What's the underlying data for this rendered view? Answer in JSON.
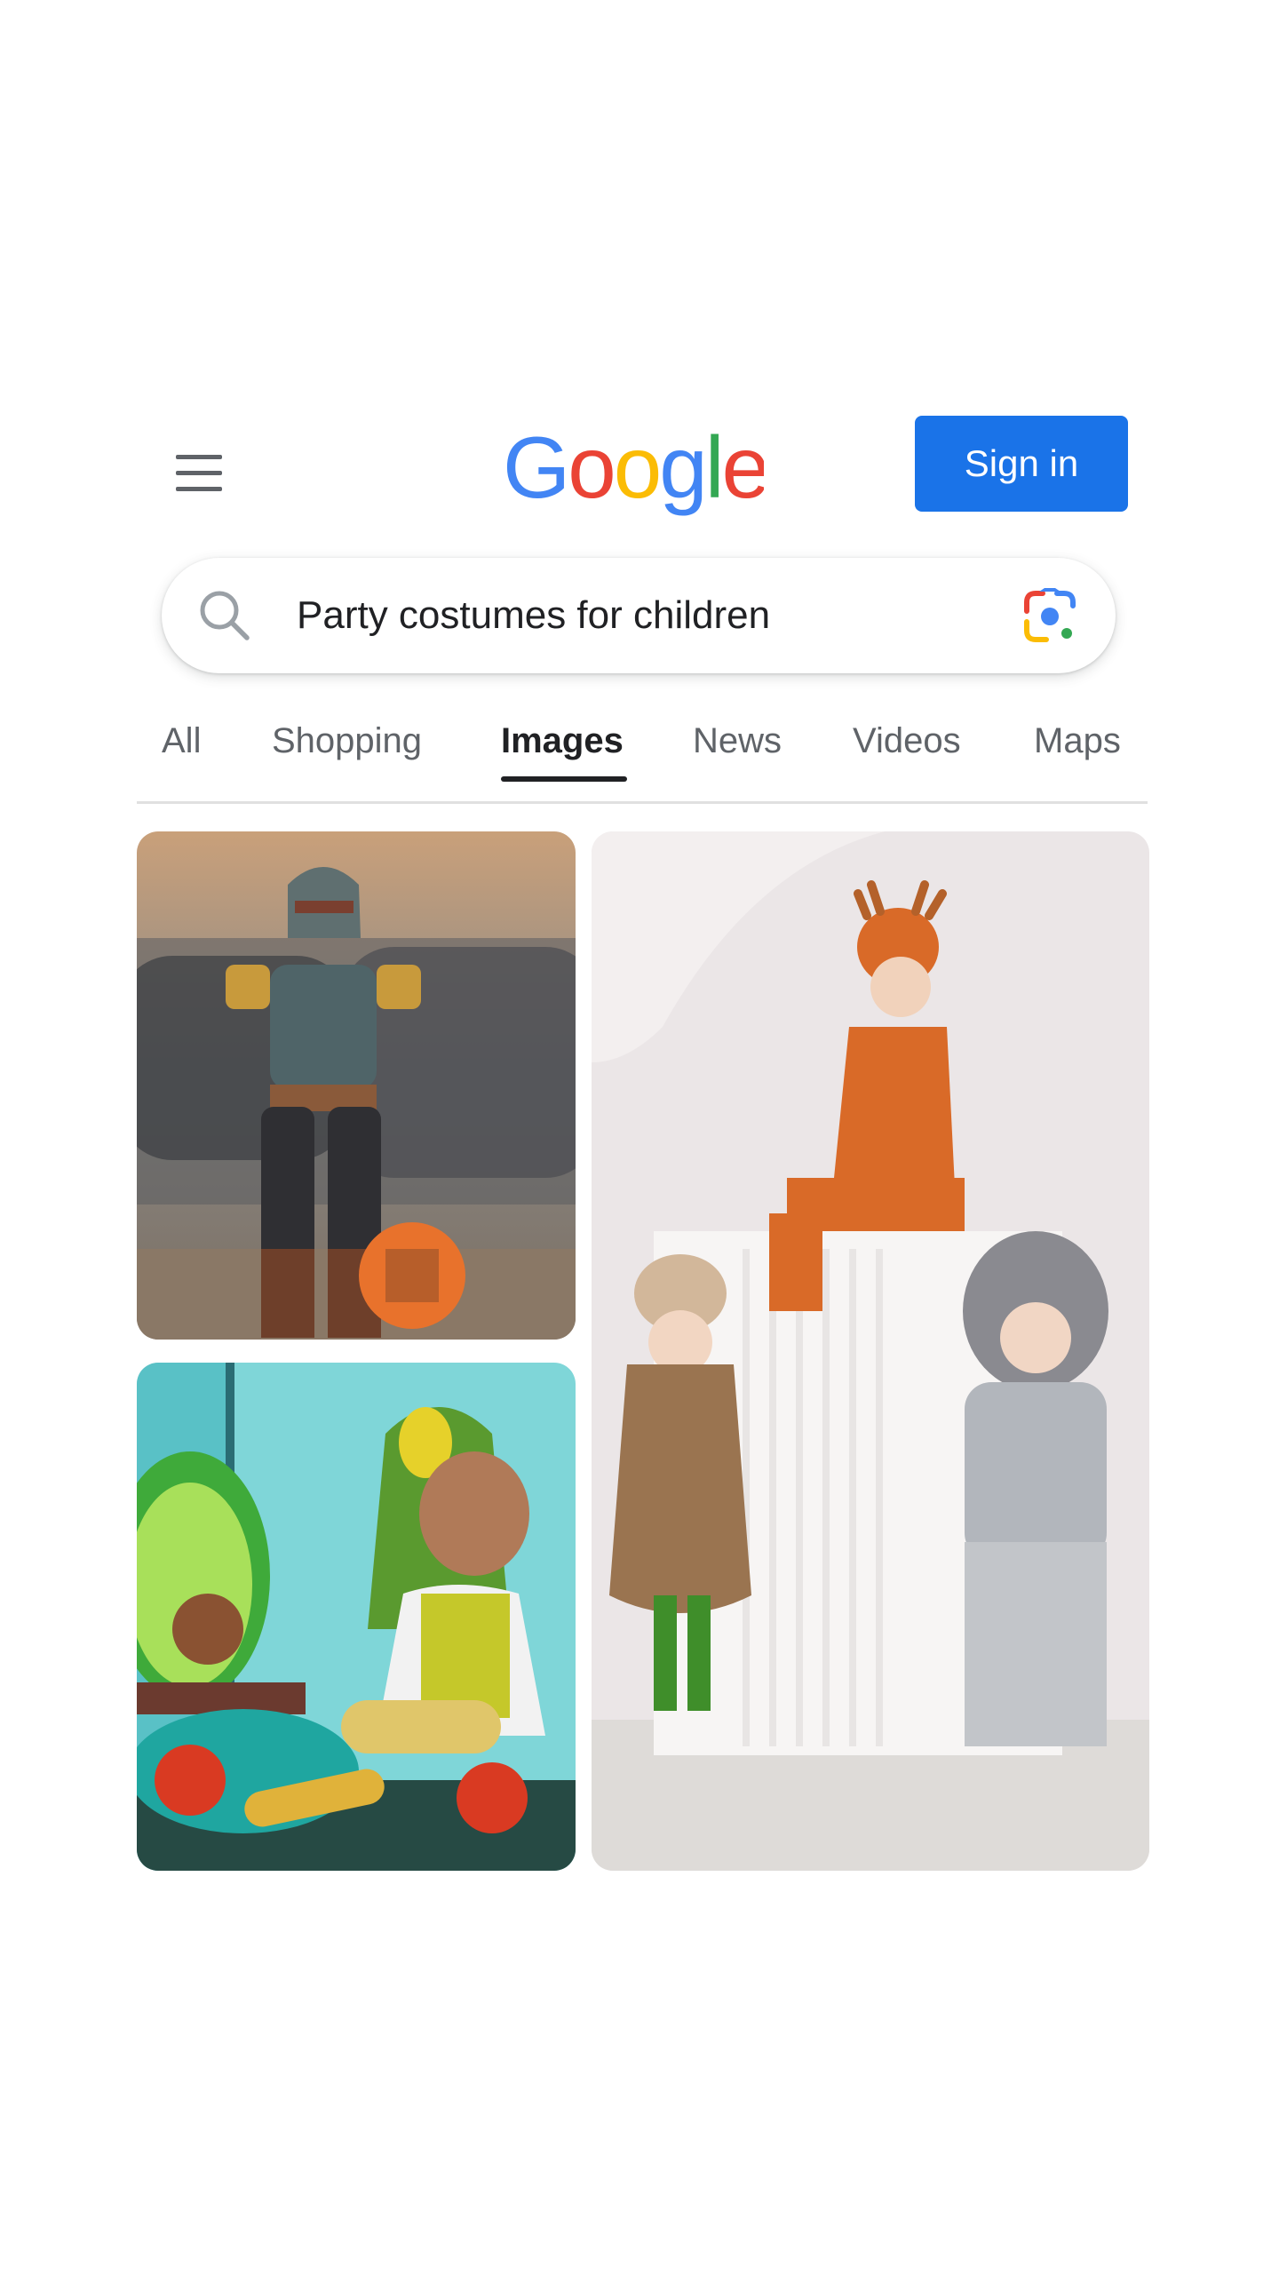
{
  "header": {
    "menu_icon": "hamburger-menu-icon",
    "logo": {
      "text": "Google",
      "letters": [
        {
          "char": "G",
          "color": "#4285F4"
        },
        {
          "char": "o",
          "color": "#EA4335"
        },
        {
          "char": "o",
          "color": "#FBBC05"
        },
        {
          "char": "g",
          "color": "#4285F4"
        },
        {
          "char": "l",
          "color": "#34A853"
        },
        {
          "char": "e",
          "color": "#EA4335"
        }
      ]
    },
    "signin_label": "Sign in"
  },
  "search": {
    "value": "Party costumes for children",
    "search_icon": "search-icon",
    "lens_icon": "google-lens-icon"
  },
  "tabs": {
    "items": [
      {
        "label": "All",
        "active": false
      },
      {
        "label": "Shopping",
        "active": false
      },
      {
        "label": "Images",
        "active": true
      },
      {
        "label": "News",
        "active": false
      },
      {
        "label": "Videos",
        "active": false
      },
      {
        "label": "Maps",
        "active": false
      }
    ]
  },
  "results": {
    "images": [
      {
        "subject": "child in armored space-helmet costume holding pumpkin candy bucket"
      },
      {
        "subject": "baby in green avocado hooded costume beside avocado toy"
      },
      {
        "subject": "three children in deer, mushroom and hedgehog costumes"
      }
    ]
  },
  "colors": {
    "accent": "#1a73e8",
    "active_tab": "#202124",
    "inactive_tab": "#5f6368"
  }
}
